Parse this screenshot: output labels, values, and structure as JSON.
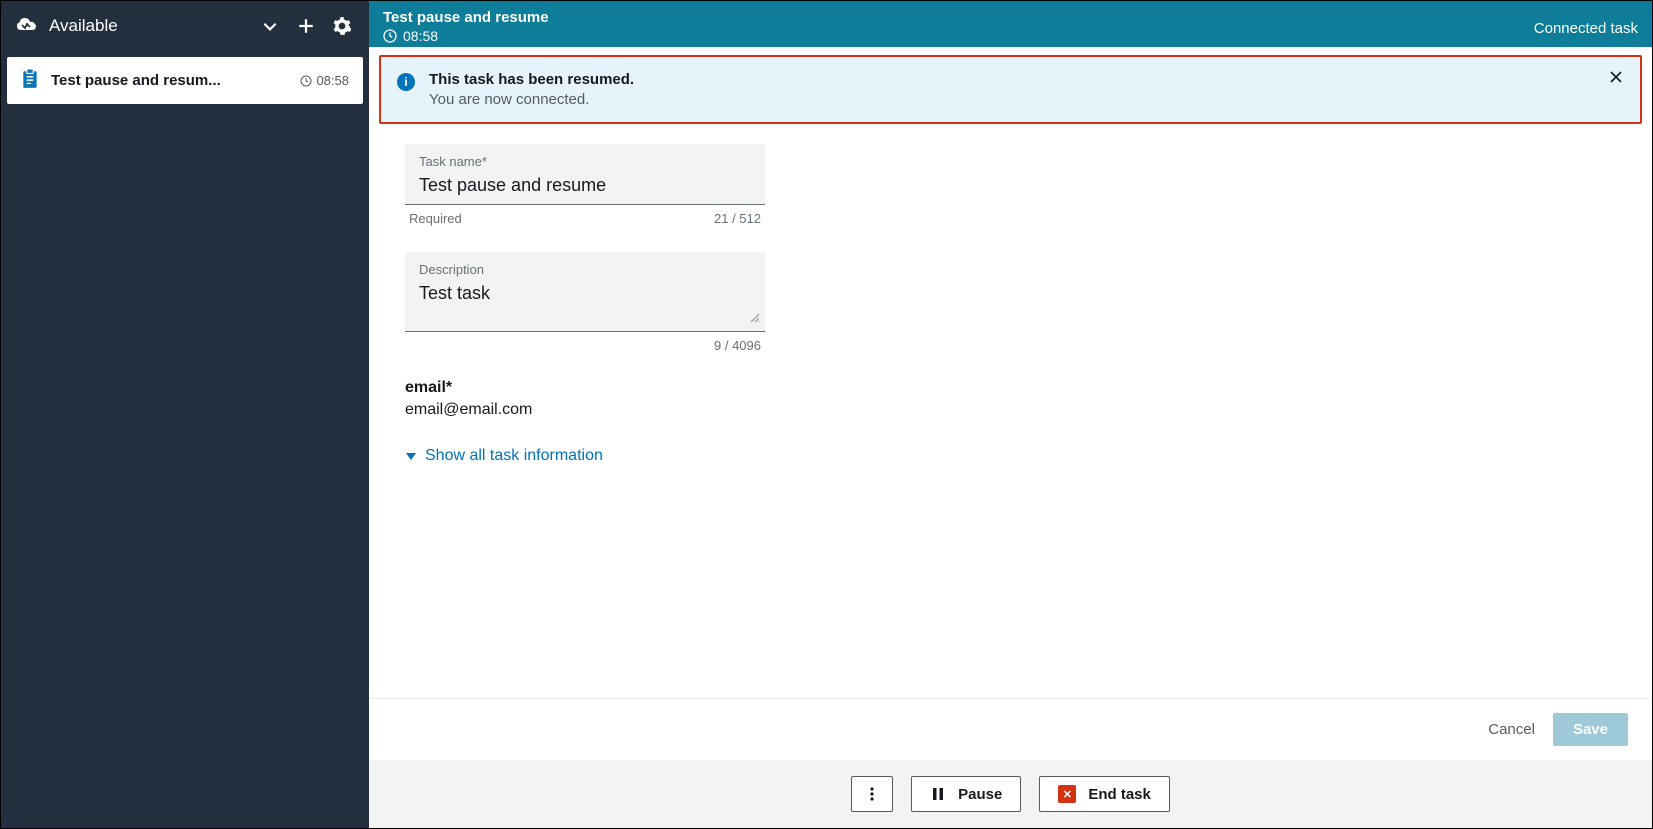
{
  "sidebar": {
    "status": "Available",
    "task": {
      "title": "Test pause and resum...",
      "time": "08:58"
    }
  },
  "header": {
    "title": "Test pause and resume",
    "time": "08:58",
    "status": "Connected task"
  },
  "banner": {
    "title": "This task has been resumed.",
    "subtitle": "You are now connected."
  },
  "form": {
    "task_name": {
      "label": "Task name*",
      "value": "Test pause and resume",
      "hint": "Required",
      "counter": "21 / 512"
    },
    "description": {
      "label": "Description",
      "value": "Test task",
      "counter": "9 / 4096"
    },
    "email": {
      "label": "email*",
      "value": "email@email.com"
    },
    "expand_link": "Show all task information"
  },
  "footer": {
    "cancel": "Cancel",
    "save": "Save"
  },
  "actions": {
    "pause": "Pause",
    "end": "End task"
  }
}
